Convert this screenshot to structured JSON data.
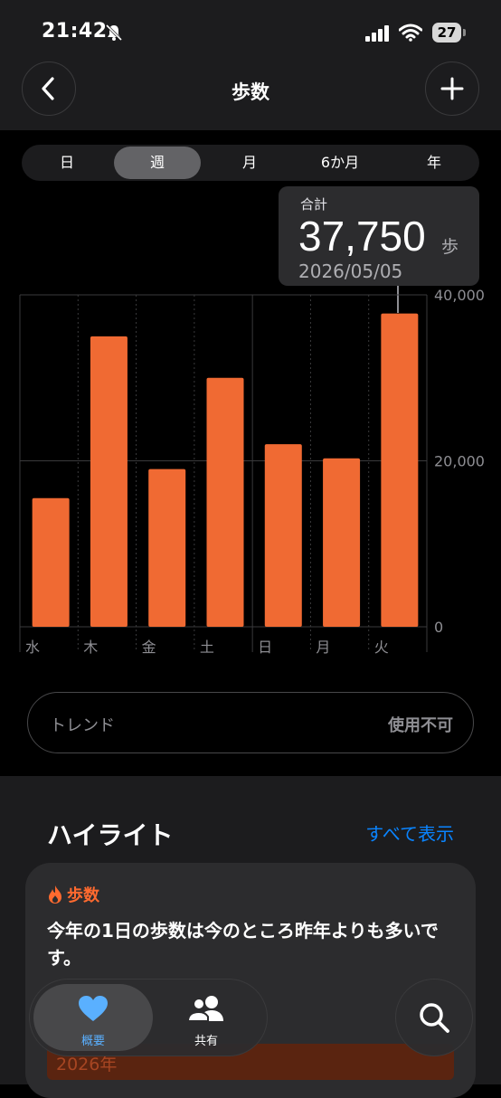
{
  "status_bar": {
    "time": "21:42",
    "battery": "27"
  },
  "header": {
    "title": "歩数"
  },
  "period_tabs": [
    "日",
    "週",
    "月",
    "6か月",
    "年"
  ],
  "selected_period": "週",
  "tooltip": {
    "label": "合計",
    "value": "37,750",
    "unit": "歩",
    "date": "2026/05/05"
  },
  "chart_data": {
    "type": "bar",
    "categories": [
      "水",
      "木",
      "金",
      "土",
      "日",
      "月",
      "火"
    ],
    "values": [
      15500,
      35000,
      19000,
      30000,
      22000,
      20300,
      37750
    ],
    "ylim": [
      0,
      40000
    ],
    "ytick_labels": [
      "40,000",
      "20,000",
      "0"
    ],
    "y_axis_position": "right",
    "grid": true,
    "color": "#f06a33"
  },
  "trend": {
    "label": "トレンド",
    "value": "使用不可"
  },
  "highlights": {
    "title": "ハイライト",
    "show_all": "すべて表示",
    "card": {
      "category": "歩数",
      "text": "今年の1日の歩数は今のところ昨年よりも多いです。",
      "bar_label": "2026年"
    }
  },
  "tabbar": {
    "summary": "概要",
    "sharing": "共有"
  },
  "colors": {
    "accent": "#0a84ff",
    "steps": "#f06a33",
    "summary_tab": "#5ab0ff"
  }
}
